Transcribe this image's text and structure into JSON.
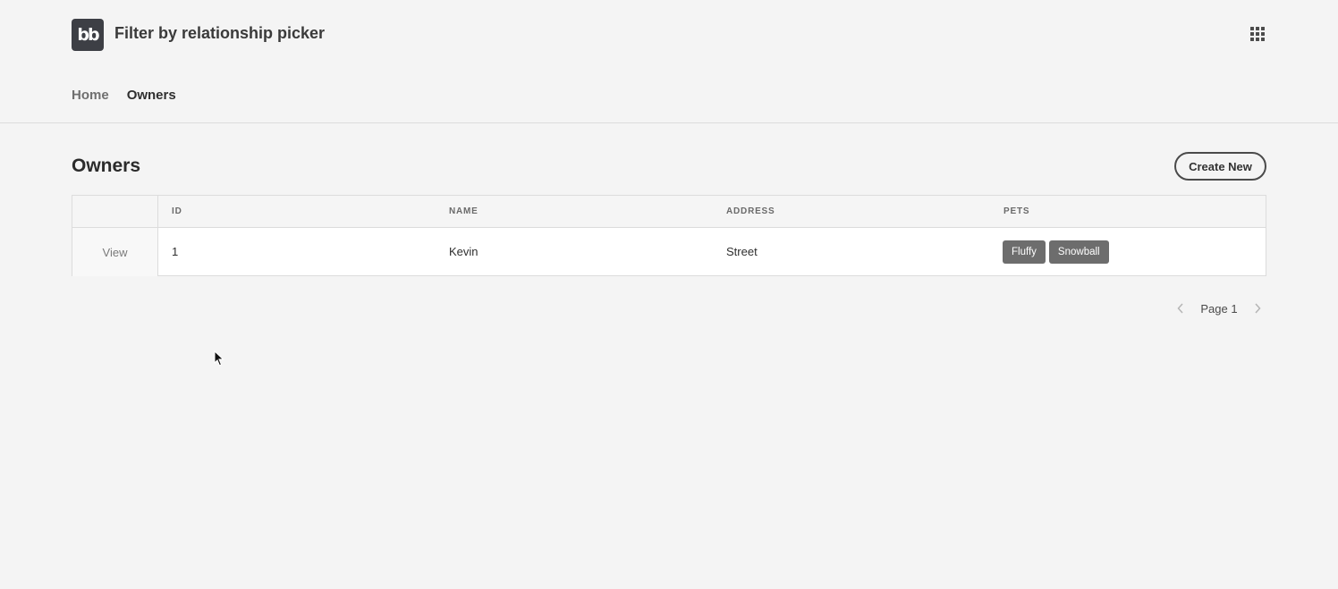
{
  "app": {
    "logo_text": "bb",
    "title": "Filter by relationship picker",
    "apps_icon": "apps-grid-icon"
  },
  "nav": {
    "items": [
      {
        "label": "Home",
        "active": false
      },
      {
        "label": "Owners",
        "active": true
      }
    ]
  },
  "page": {
    "title": "Owners",
    "create_label": "Create New"
  },
  "table": {
    "columns": [
      "ID",
      "NAME",
      "ADDRESS",
      "PETS"
    ],
    "rows": [
      {
        "action": "View",
        "id": "1",
        "name": "Kevin",
        "address": "Street",
        "pets": [
          "Fluffy",
          "Snowball"
        ]
      }
    ]
  },
  "pagination": {
    "label": "Page 1",
    "prev_icon": "chevron-left-icon",
    "next_icon": "chevron-right-icon"
  },
  "colors": {
    "background": "#f4f4f4",
    "logo_bg": "#3d3f45",
    "tag_bg": "#6d6d6d"
  }
}
